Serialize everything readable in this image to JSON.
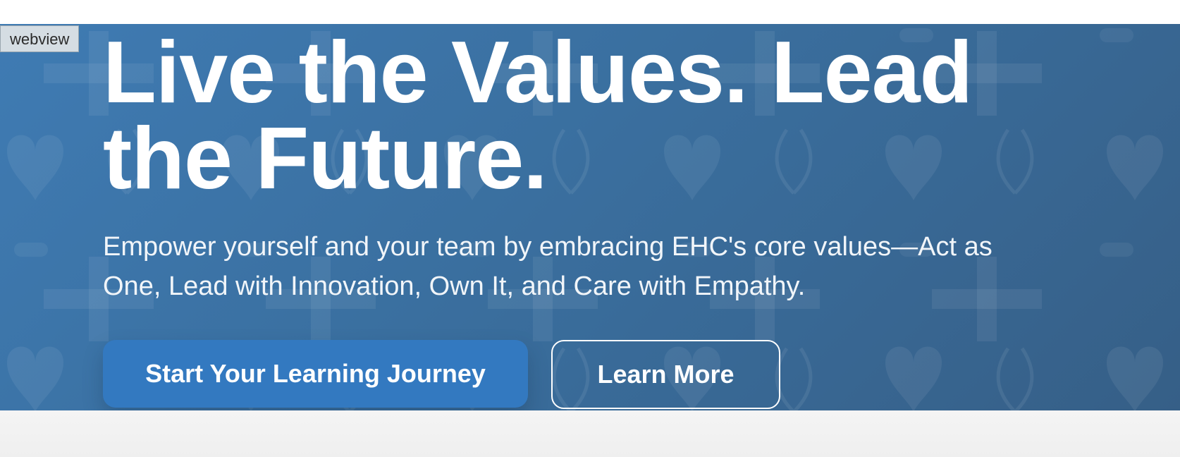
{
  "webview_tag": "webview",
  "hero": {
    "title": "Live the Values. Lead the Future.",
    "subtitle": "Empower yourself and your team by embracing EHC's core values—Act as One, Lead with Innovation, Own It, and Care with Empathy.",
    "primary_button": "Start Your Learning Journey",
    "secondary_button": "Learn More",
    "pattern_icons": [
      "heart-icon",
      "cross-icon",
      "ribbon-icon"
    ]
  },
  "colors": {
    "hero_gradient_start": "#3f7bb3",
    "hero_gradient_end": "#365f87",
    "primary_button": "#3379c0",
    "text": "#ffffff",
    "page_below": "#f2f2f2"
  }
}
